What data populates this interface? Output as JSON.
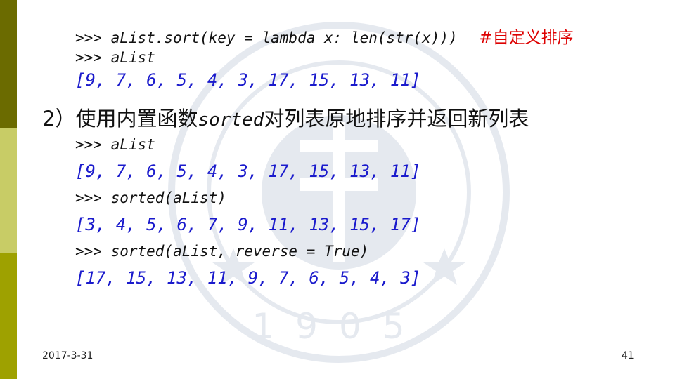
{
  "colors": {
    "sidebar_dark": "#6b6b00",
    "sidebar_light": "#c8cc66",
    "sidebar_mid": "#9ea100",
    "output_blue": "#1a1acc",
    "comment_red": "#dd0000"
  },
  "watermark": {
    "icon": "university-seal-watermark",
    "year": "1905"
  },
  "block1": {
    "cmd1": ">>> aList.sort(key = lambda x: len(str(x)))",
    "cmd1_comment": "#自定义排序",
    "cmd2": ">>> aList",
    "out1": "[9, 7, 6, 5, 4, 3, 17, 15, 13, 11]"
  },
  "heading": {
    "prefix": "2）使用内置函数",
    "keyword": "sorted",
    "suffix": "对列表原地排序并返回新列表"
  },
  "block2": {
    "cmd1": ">>> aList",
    "out1": "[9, 7, 6, 5, 4, 3, 17, 15, 13, 11]",
    "cmd2": ">>> sorted(aList)",
    "out2": "[3, 4, 5, 6, 7, 9, 11, 13, 15, 17]",
    "cmd3": ">>> sorted(aList, reverse = True)",
    "out3": "[17, 15, 13, 11, 9, 7, 6, 5, 4, 3]"
  },
  "footer": {
    "date": "2017-3-31",
    "page": "41"
  }
}
